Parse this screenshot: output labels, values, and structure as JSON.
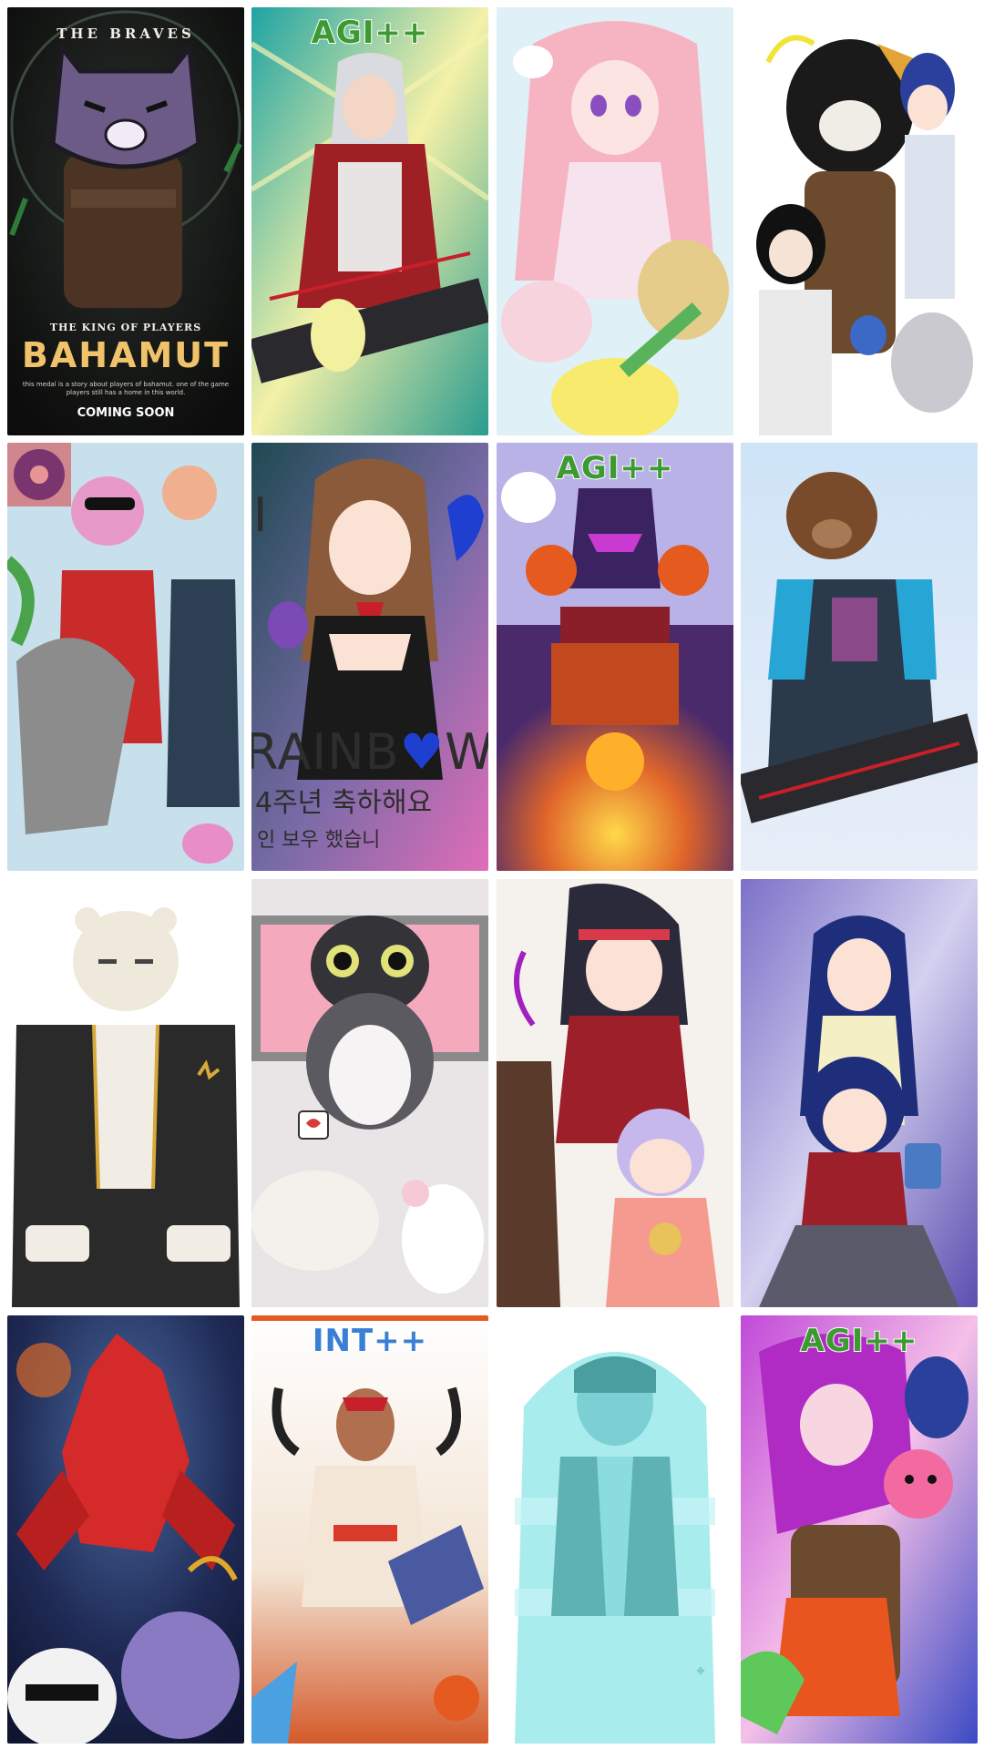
{
  "gallery": {
    "cards": [
      {
        "id": "bahamut-poster",
        "poster": {
          "top_text": "THE BRAVES",
          "subtitle": "THE KING OF PLAYERS",
          "title": "BAHAMUT",
          "blurb": "this medal is a story about players of bahamut. one of the game players still has a home in this world.",
          "cta": "COMING SOON"
        }
      },
      {
        "id": "maid-warrior",
        "badge": "AGI++",
        "badge_color": "#3d9a32"
      },
      {
        "id": "pink-girl-sheep",
        "badge": ""
      },
      {
        "id": "bear-knight-group",
        "badge": ""
      },
      {
        "id": "pink-panther-crew",
        "badge": ""
      },
      {
        "id": "rainbow-maid",
        "rainbow": {
          "title_a": "RAINB",
          "title_heart": "♥",
          "title_b": "W",
          "korean_line1": "4주년 축하해요",
          "korean_line2": "인 보우 했습니",
          "side_glyph": "I"
        }
      },
      {
        "id": "dark-knight-fire",
        "badge": "AGI++",
        "badge_color": "#3d9a32"
      },
      {
        "id": "bear-mask-gunner",
        "badge": ""
      },
      {
        "id": "polar-bear",
        "badge": ""
      },
      {
        "id": "cat-penguin",
        "badge": ""
      },
      {
        "id": "shrine-girls",
        "badge": ""
      },
      {
        "id": "blue-hair-twins",
        "badge": ""
      },
      {
        "id": "red-mecha",
        "badge": ""
      },
      {
        "id": "warrior-int",
        "badge": "INT++",
        "badge_color": "#3a7fd6"
      },
      {
        "id": "ghost-boy",
        "badge": ""
      },
      {
        "id": "purple-hair-group",
        "badge": "AGI++",
        "badge_color": "#3d9a32"
      }
    ]
  }
}
